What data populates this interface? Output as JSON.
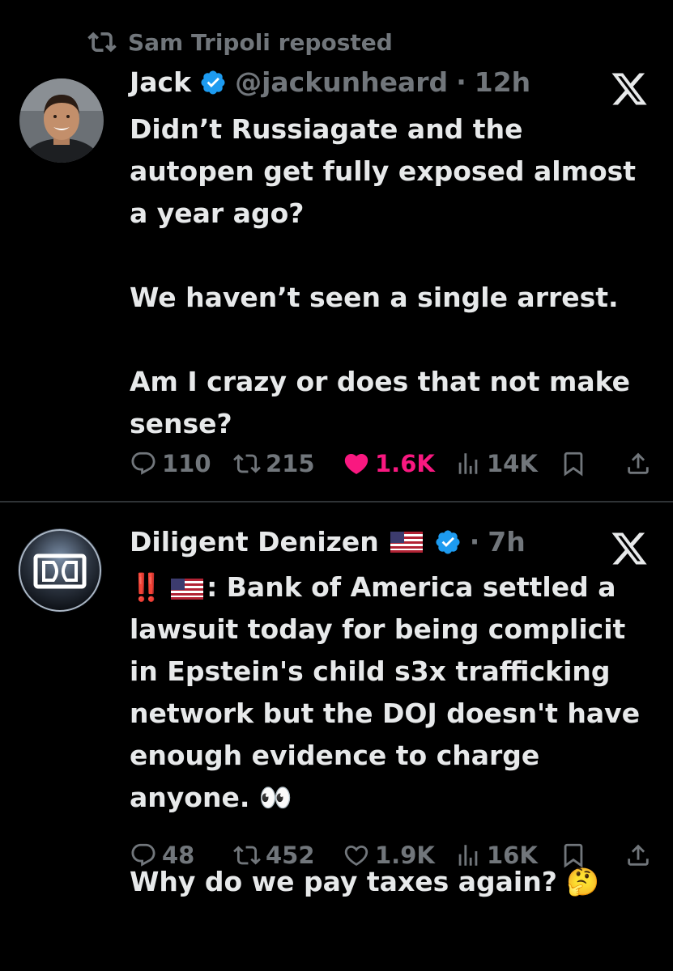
{
  "tweets": [
    {
      "repost_by": "Sam Tripoli reposted",
      "name": "Jack",
      "handle": "@jackunheard",
      "separator": "·",
      "time": "12h",
      "body": [
        "Didn’t Russiagate and the",
        "autopen get fully exposed almost",
        "a year ago?",
        "",
        "We haven’t seen a single arrest.",
        "",
        "Am I crazy or does that not make",
        "sense?"
      ],
      "stats": {
        "replies": "110",
        "reposts": "215",
        "likes": "1.6K",
        "views": "14K"
      },
      "liked": true
    },
    {
      "name": "Diligent Denizen",
      "separator": "·",
      "time": "7h",
      "body_first": "‼️",
      "body_first_rest": ": Bank of America settled a",
      "body": [
        "lawsuit today for being complicit",
        "in Epstein's child s3x trafficking",
        "network but the DOJ doesn't have",
        "enough evidence to charge",
        "anyone. 👀",
        "",
        "Why do we pay taxes again? 🤔"
      ],
      "stats": {
        "replies": "48",
        "reposts": "452",
        "likes": "1.9K",
        "views": "16K"
      },
      "liked": false
    }
  ],
  "colors": {
    "background": "#000000",
    "text": "#e7e9ea",
    "muted": "#71767b",
    "verified": "#1d9bf0",
    "like": "#f91880",
    "divider": "#2f3336"
  }
}
